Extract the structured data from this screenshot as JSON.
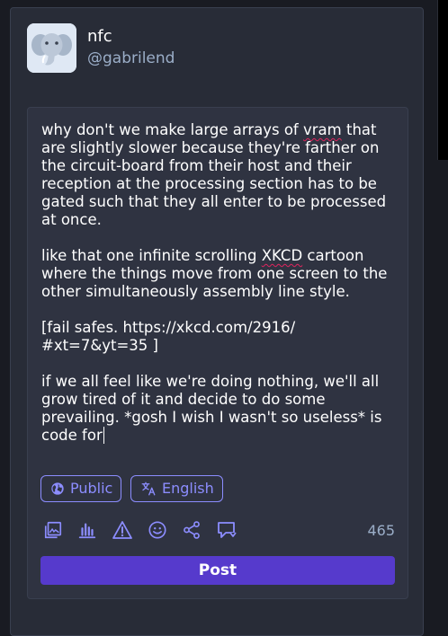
{
  "account": {
    "display_name": "nfc",
    "handle": "@gabrilend"
  },
  "compose": {
    "paragraphs": [
      {
        "text_before": "why don't we make large arrays of ",
        "flagged": "vram",
        "text_after": " that are slightly slower because they're farther on the circuit-board from their host and their reception at the processing section has to be gated such that they all enter to be processed at once."
      },
      {
        "text_before": "like that one infinite scrolling ",
        "flagged": "XKCD",
        "text_after": " cartoon where the things move from one screen to the other simultaneously assembly line style."
      },
      {
        "text_before": "[fail safes. https://xkcd.com/2916/\n#xt=7&yt=35 ]",
        "flagged": "",
        "text_after": ""
      },
      {
        "text_before": "if we all feel like we're doing nothing, we'll all grow tired of it and decide to do some prevailing. *gosh I wish I wasn't so useless* is code for",
        "flagged": "",
        "text_after": ""
      }
    ]
  },
  "options": {
    "visibility_label": "Public",
    "language_label": "English"
  },
  "toolbar": {
    "icons": [
      "image-icon",
      "poll-icon",
      "warning-icon",
      "emoji-icon",
      "share-icon",
      "quote-icon"
    ],
    "character_counter": "465"
  },
  "actions": {
    "post_label": "Post"
  },
  "colors": {
    "accent": "#8c8dff",
    "post_button": "#563acc",
    "panel": "#282c37",
    "compose_bg": "#2f3341",
    "secondary_text": "#9baec8"
  }
}
